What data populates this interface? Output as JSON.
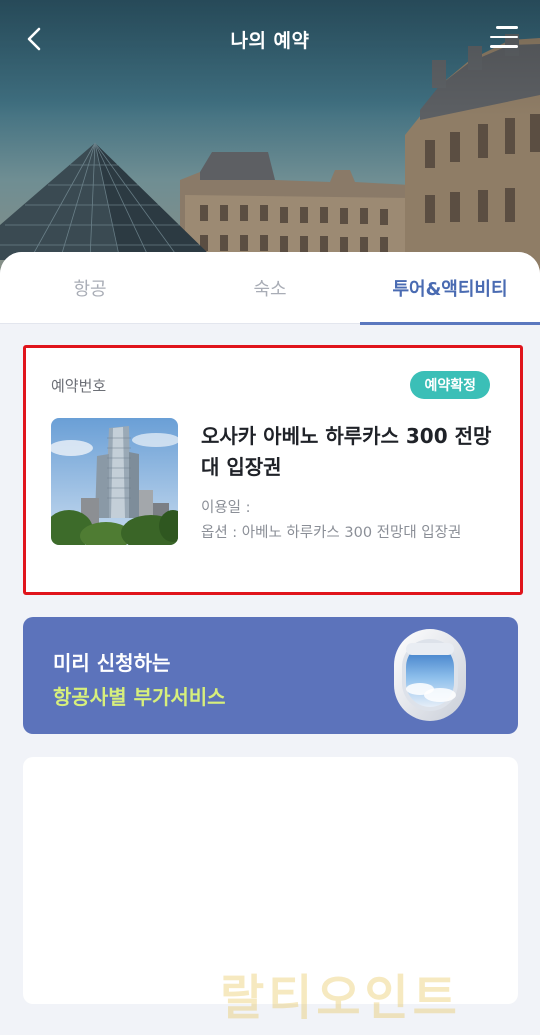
{
  "header": {
    "title": "나의 예약",
    "back_icon": "chevron-left-icon",
    "menu_icon": "hamburger-menu-icon"
  },
  "tabs": [
    {
      "label": "항공",
      "active": false
    },
    {
      "label": "숙소",
      "active": false
    },
    {
      "label": "투어&액티비티",
      "active": true
    }
  ],
  "booking": {
    "reservation_label": "예약번호",
    "status_badge": "예약확정",
    "title": "오사카 아베노 하루카스 300 전망대 입장권",
    "use_date_label": "이용일 :",
    "option_text": "옵션 : 아베노 하루카스 300 전망대 입장권"
  },
  "promo": {
    "line1": "미리 신청하는",
    "line2": "항공사별 부가서비스",
    "icon": "airplane-window-icon"
  },
  "watermark": "랄티오인트",
  "colors": {
    "accent": "#4a6bb2",
    "badge": "#3bbfb7",
    "highlight_border": "#e0141c",
    "promo_bg": "#5c73bb",
    "promo_highlight": "#d7ef7c"
  }
}
